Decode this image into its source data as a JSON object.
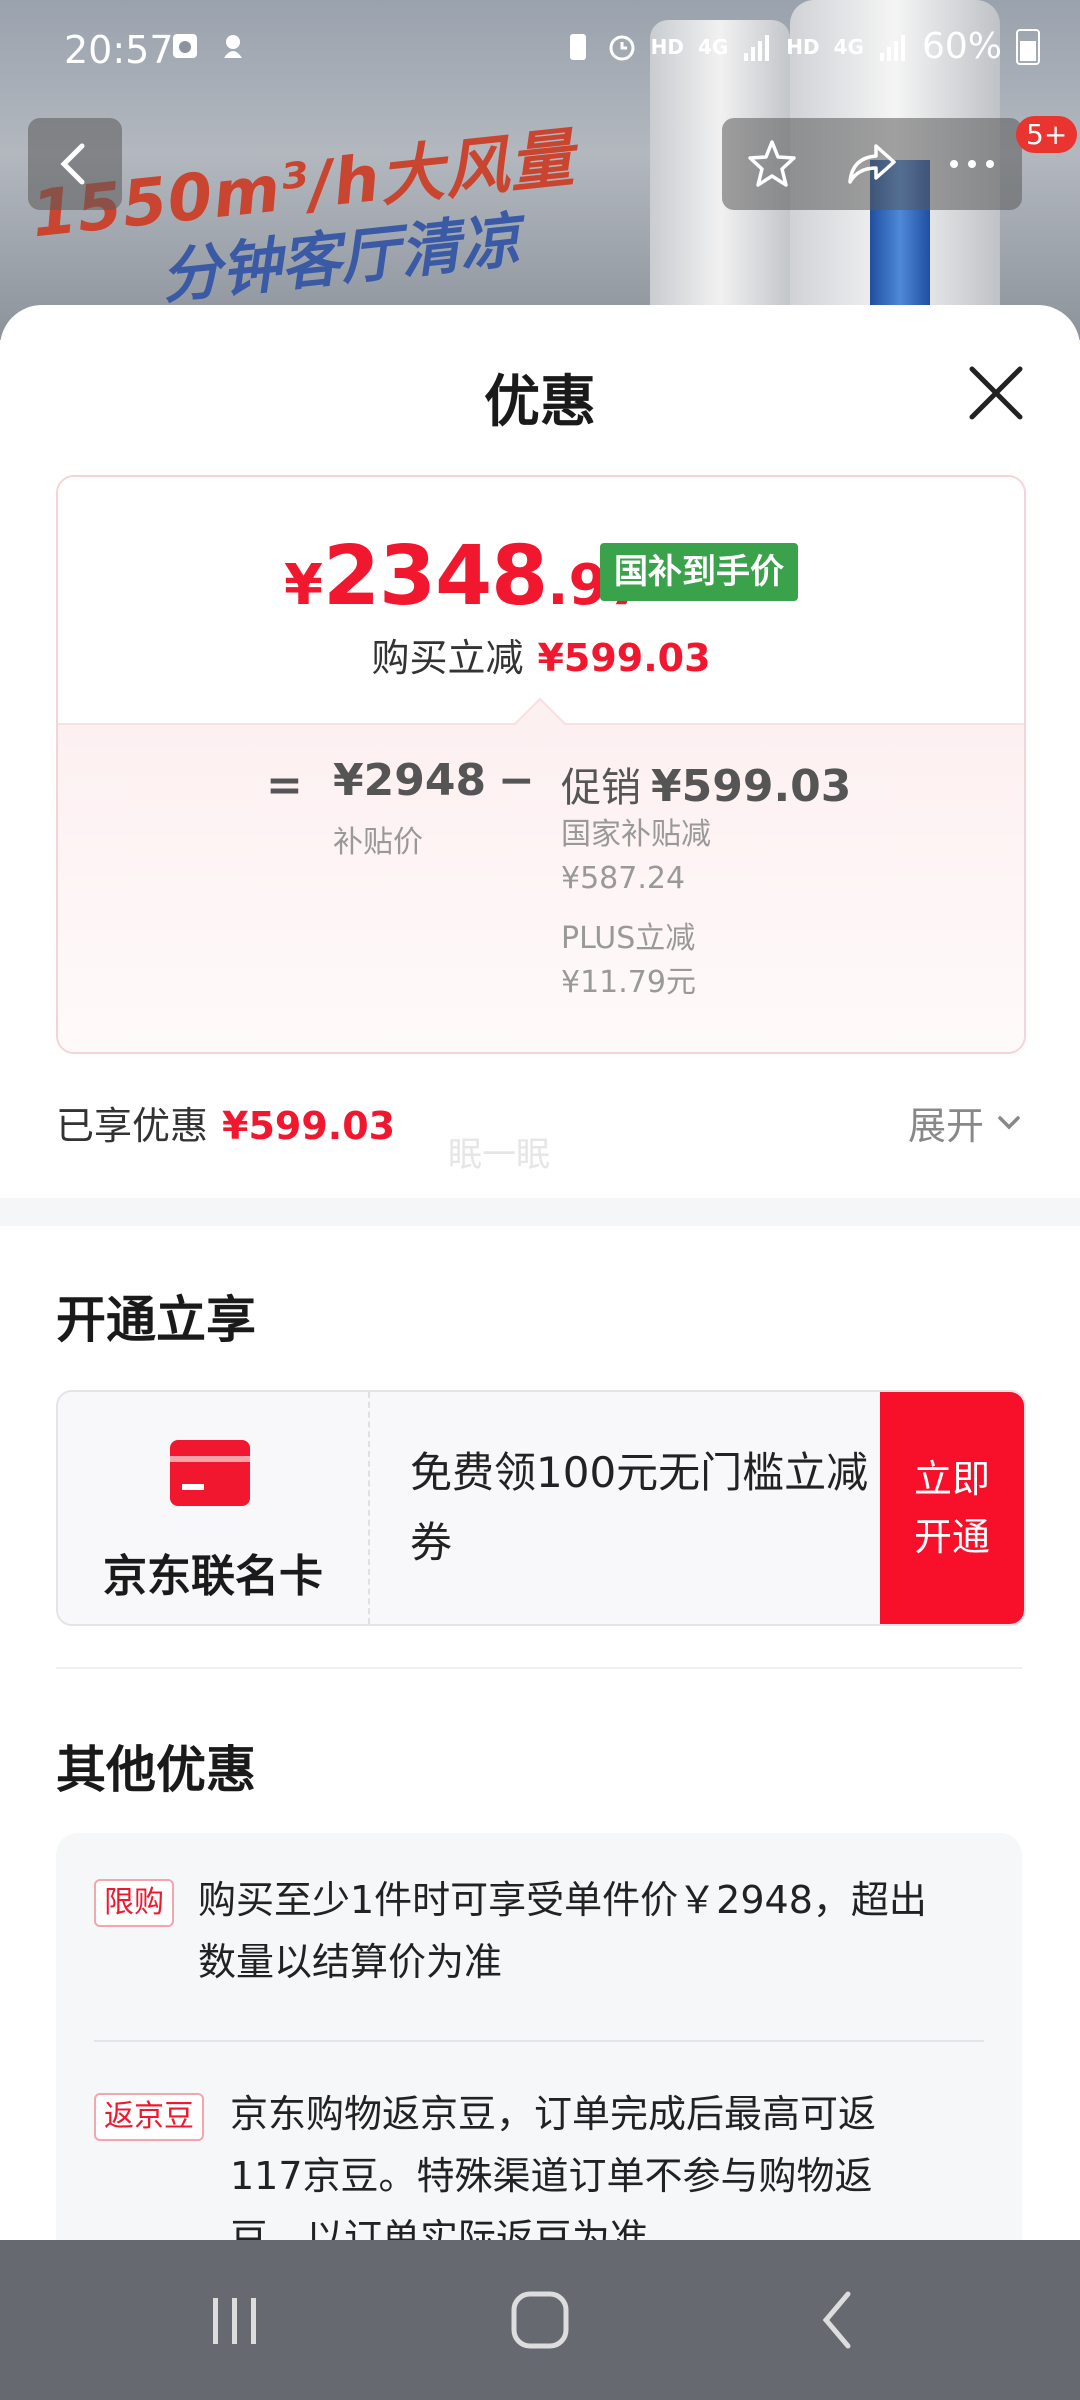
{
  "status_bar": {
    "time": "20:57",
    "signal_labels": [
      "HD",
      "4G",
      "HD",
      "4G"
    ],
    "battery": "60%"
  },
  "background": {
    "banner_line1": "1550m³/h大风量",
    "banner_line2": "分钟客厅清凉",
    "notification_badge": "5+"
  },
  "sheet": {
    "title": "优惠",
    "price": {
      "symbol": "¥",
      "integer": "2348",
      "decimal": ".97",
      "tag": "国补到手价",
      "reduce_label": "购买立减",
      "reduce_value": "¥599.03"
    },
    "breakdown": {
      "equals": "=",
      "subsidy_price": "¥2948",
      "subsidy_label": "补贴价",
      "minus": "−",
      "promo_label": "促销",
      "promo_value": "¥599.03",
      "details": [
        {
          "label": "国家补贴减",
          "value": "¥587.24"
        },
        {
          "label": "PLUS立减",
          "value": "¥11.79元"
        }
      ]
    },
    "enjoyed_label": "已享优惠",
    "enjoyed_value": "¥599.03",
    "expand_label": "展开",
    "watermark": "眠一眠"
  },
  "open_section": {
    "title": "开通立享",
    "card_name": "京东联名卡",
    "offer_text": "免费领100元无门槛立减券",
    "button_label": "立即开通"
  },
  "other_section": {
    "title": "其他优惠",
    "items": [
      {
        "tag": "限购",
        "text": "购买至少1件时可享受单件价￥2948，超出数量以结算价为准"
      },
      {
        "tag": "返京豆",
        "text": "京东购物返京豆，订单完成后最高可返117京豆。特殊渠道订单不参与购物返豆，以订单实际返豆为准。"
      }
    ]
  },
  "colors": {
    "accent_red": "#f0172e",
    "tag_green": "#3aa24a",
    "button_red": "#f8102b"
  },
  "icons": [
    "back-arrow-icon",
    "star-icon",
    "share-icon",
    "more-icon",
    "close-icon",
    "credit-card-icon",
    "chevron-down-icon",
    "recent-apps-icon",
    "home-icon",
    "nav-back-icon"
  ]
}
